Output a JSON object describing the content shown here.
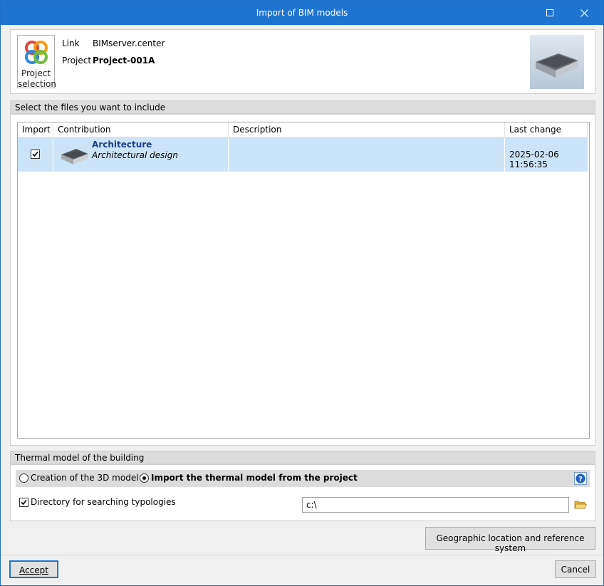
{
  "window": {
    "title": "Import of BIM models"
  },
  "project_panel": {
    "selection_button_line1": "Project",
    "selection_button_line2": "selection",
    "link_label": "Link",
    "link_value": "BIMserver.center",
    "project_label": "Project",
    "project_value": "Project-001A"
  },
  "files_section": {
    "header": "Select the files you want to include",
    "columns": [
      "Import",
      "Contribution",
      "Description",
      "Last change"
    ],
    "rows": [
      {
        "import_checked": true,
        "contribution_title": "Architecture",
        "contribution_subtitle": "Architectural design",
        "description": "",
        "last_change": "2025-02-06 11:56:35"
      }
    ]
  },
  "thermal_section": {
    "header": "Thermal model of the building",
    "option_create": "Creation of the 3D model",
    "option_import": "Import the thermal model from the project",
    "selected_option": "import",
    "directory_checkbox_label": "Directory for searching typologies",
    "directory_checked": true,
    "directory_value": "c:\\"
  },
  "buttons": {
    "geographic": "Geographic location and reference system",
    "accept": "Accept",
    "cancel": "Cancel"
  },
  "colors": {
    "titlebar": "#1e74d0",
    "selected_row": "#cce4f7",
    "section_header": "#dcdcdc"
  }
}
